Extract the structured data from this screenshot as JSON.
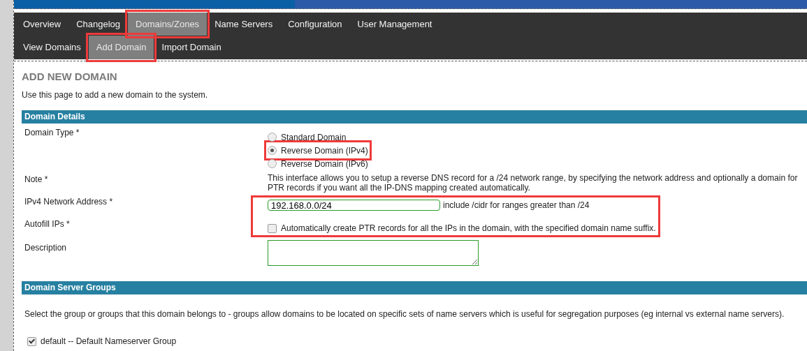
{
  "main_tabs": [
    {
      "label": "Overview",
      "selected": false,
      "highlighted": false
    },
    {
      "label": "Changelog",
      "selected": false,
      "highlighted": false
    },
    {
      "label": "Domains/Zones",
      "selected": true,
      "highlighted": true
    },
    {
      "label": "Name Servers",
      "selected": false,
      "highlighted": false
    },
    {
      "label": "Configuration",
      "selected": false,
      "highlighted": false
    },
    {
      "label": "User Management",
      "selected": false,
      "highlighted": false
    }
  ],
  "sub_tabs": [
    {
      "label": "View Domains",
      "selected": false,
      "highlighted": false
    },
    {
      "label": "Add Domain",
      "selected": true,
      "highlighted": true
    },
    {
      "label": "Import Domain",
      "selected": false,
      "highlighted": false
    }
  ],
  "page": {
    "title": "ADD NEW DOMAIN",
    "intro": "Use this page to add a new domain to the system."
  },
  "sections": [
    {
      "title": "Domain Details",
      "fields": [
        {
          "kind": "radio",
          "label": "Domain Type *",
          "options": [
            {
              "label": "Standard Domain",
              "selected": false,
              "highlighted": false
            },
            {
              "label": "Reverse Domain (IPv4)",
              "selected": true,
              "highlighted": true
            },
            {
              "label": "Reverse Domain (IPv6)",
              "selected": false,
              "highlighted": false
            }
          ]
        },
        {
          "kind": "note",
          "label": "Note *",
          "lines": [
            "This interface allows you to setup a reverse DNS record for a /24 network range, by specifying the network address and optionally a domain for",
            "PTR records if you want all the IP-DNS mapping created automatically."
          ]
        },
        {
          "kind": "text",
          "label": "IPv4 Network Address *",
          "value": "192.168.0.0/24",
          "hint": "include /cidr for ranges greater than /24",
          "highlighted": true
        },
        {
          "kind": "checkbox",
          "label": "Autofill IPs *",
          "text": "Automatically create PTR records for all the IPs in the domain, with the specified domain name suffix.",
          "checked": false,
          "highlighted": true
        },
        {
          "kind": "textarea",
          "label": "Description"
        }
      ]
    },
    {
      "title": "Domain Server Groups",
      "intro": "Select the group or groups that this domain belongs to - groups allow domains to be located on specific sets of name servers which is useful for segregation purposes (eg internal vs external name servers).",
      "groups": [
        {
          "label": "default -- Default Nameserver Group",
          "checked": true
        }
      ]
    }
  ]
}
